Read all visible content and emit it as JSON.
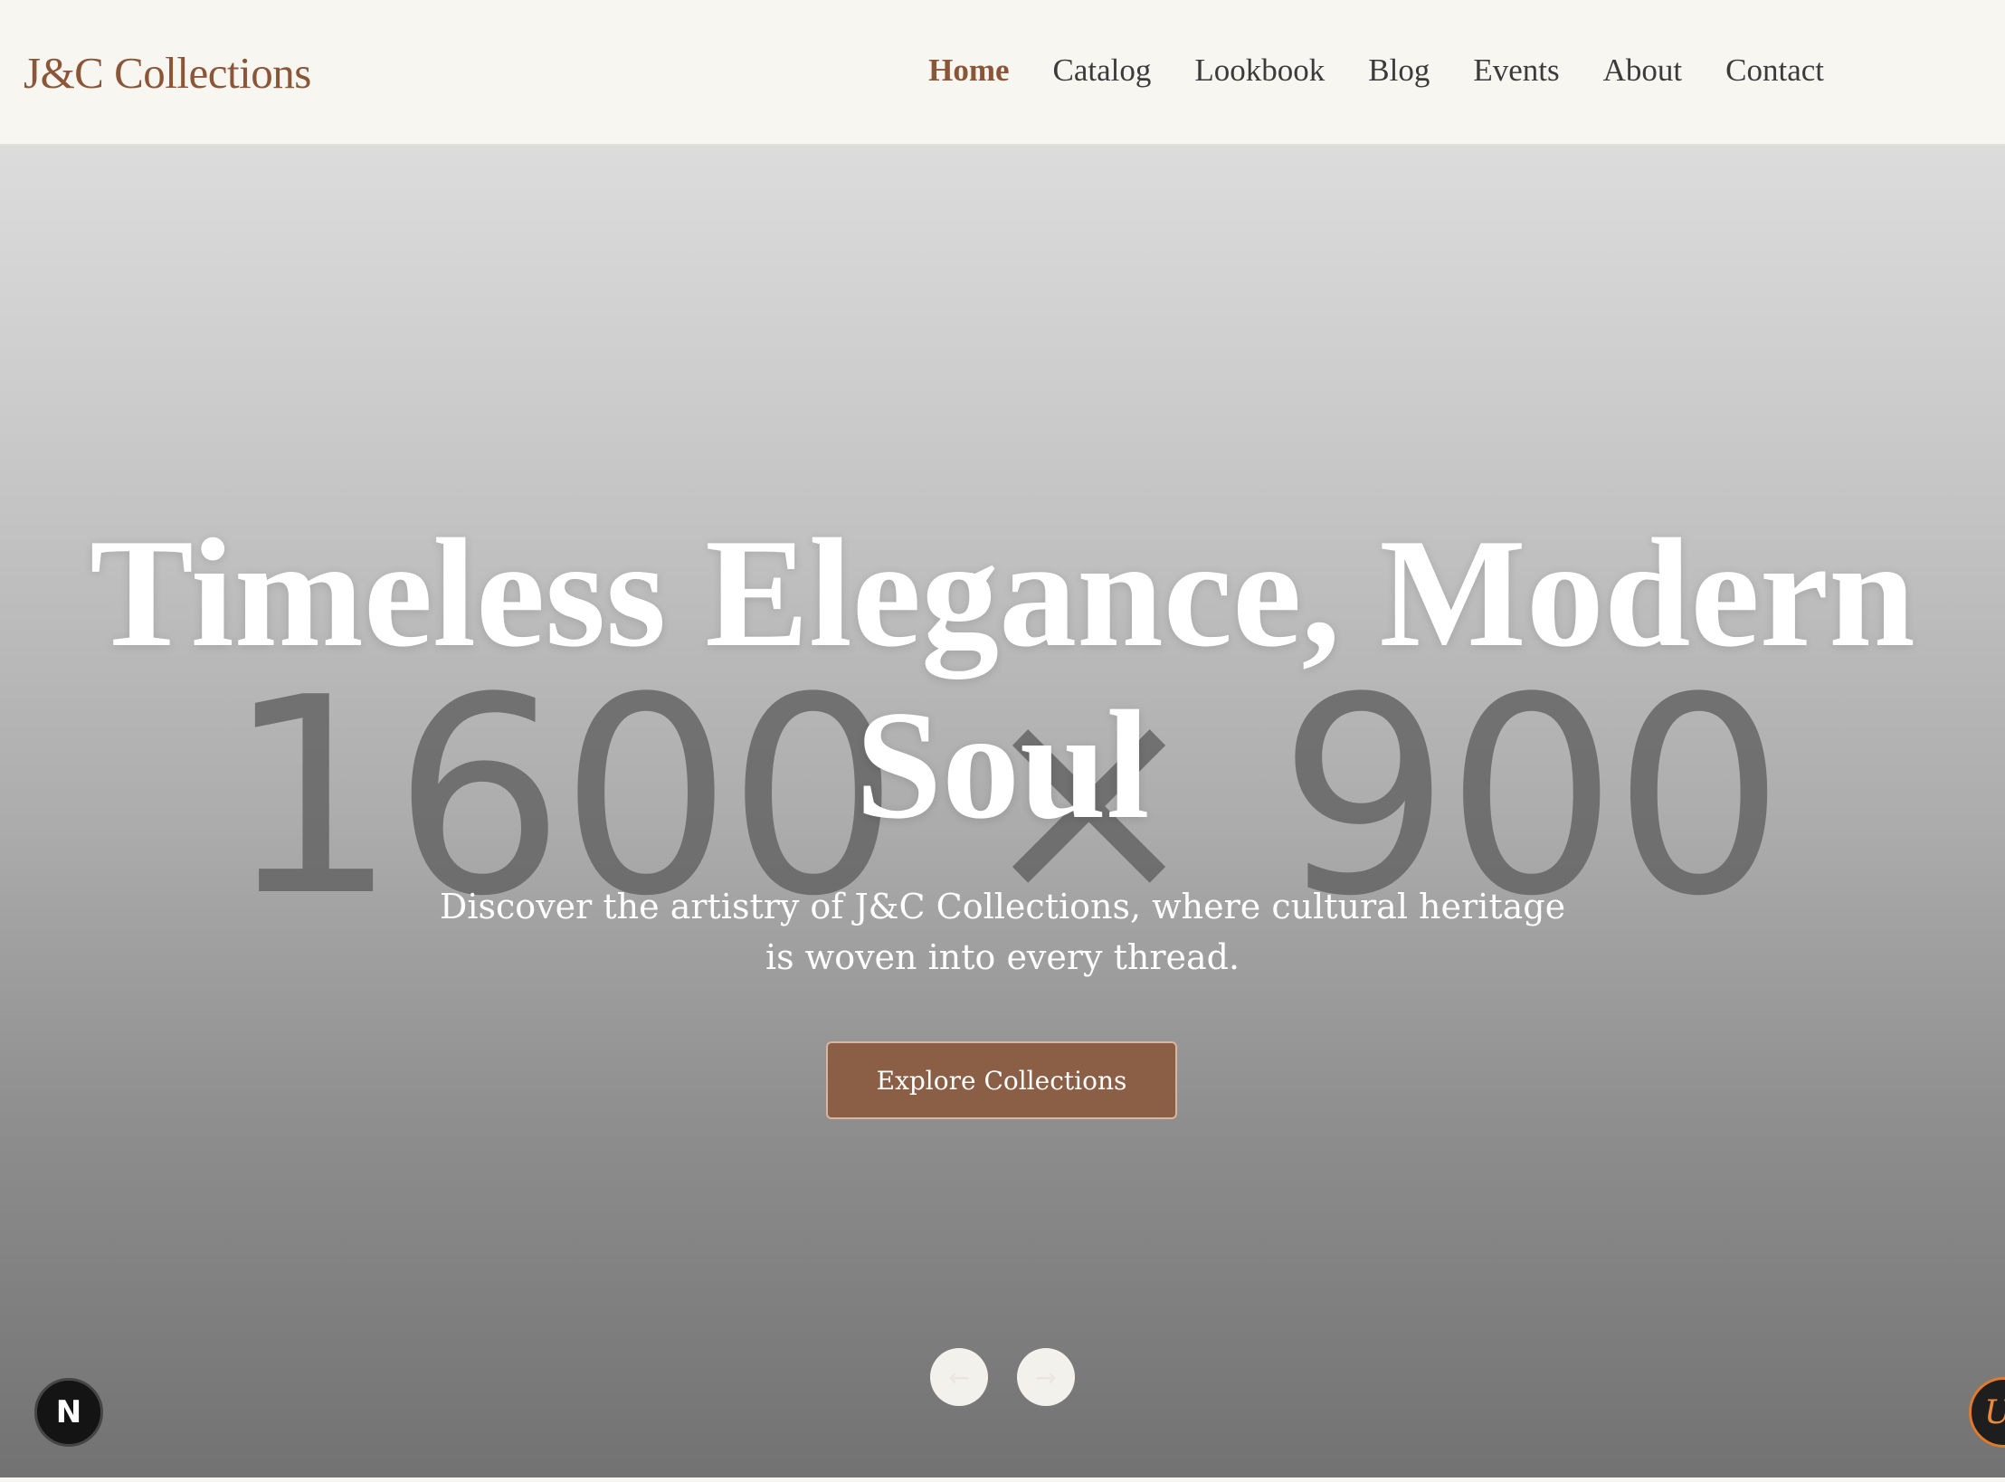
{
  "header": {
    "brand": "J&C Collections",
    "nav": [
      {
        "label": "Home",
        "active": true
      },
      {
        "label": "Catalog",
        "active": false
      },
      {
        "label": "Lookbook",
        "active": false
      },
      {
        "label": "Blog",
        "active": false
      },
      {
        "label": "Events",
        "active": false
      },
      {
        "label": "About",
        "active": false
      },
      {
        "label": "Contact",
        "active": false
      }
    ]
  },
  "hero": {
    "placeholder_text": "1600 × 900",
    "title": "Timeless Elegance, Modern Soul",
    "subtitle": "Discover the artistry of J&C Collections, where cultural heritage is woven into every thread.",
    "cta_label": "Explore Collections",
    "prev_arrow": "←",
    "next_arrow": "→"
  },
  "badges": {
    "left_badge": "N",
    "right_badge": "U"
  },
  "colors": {
    "brand": "#8b5638",
    "cta_background": "#8b5e46",
    "header_background": "#f8f6f1"
  },
  "icons": {
    "prev": "arrow-left-icon",
    "next": "arrow-right-icon"
  }
}
